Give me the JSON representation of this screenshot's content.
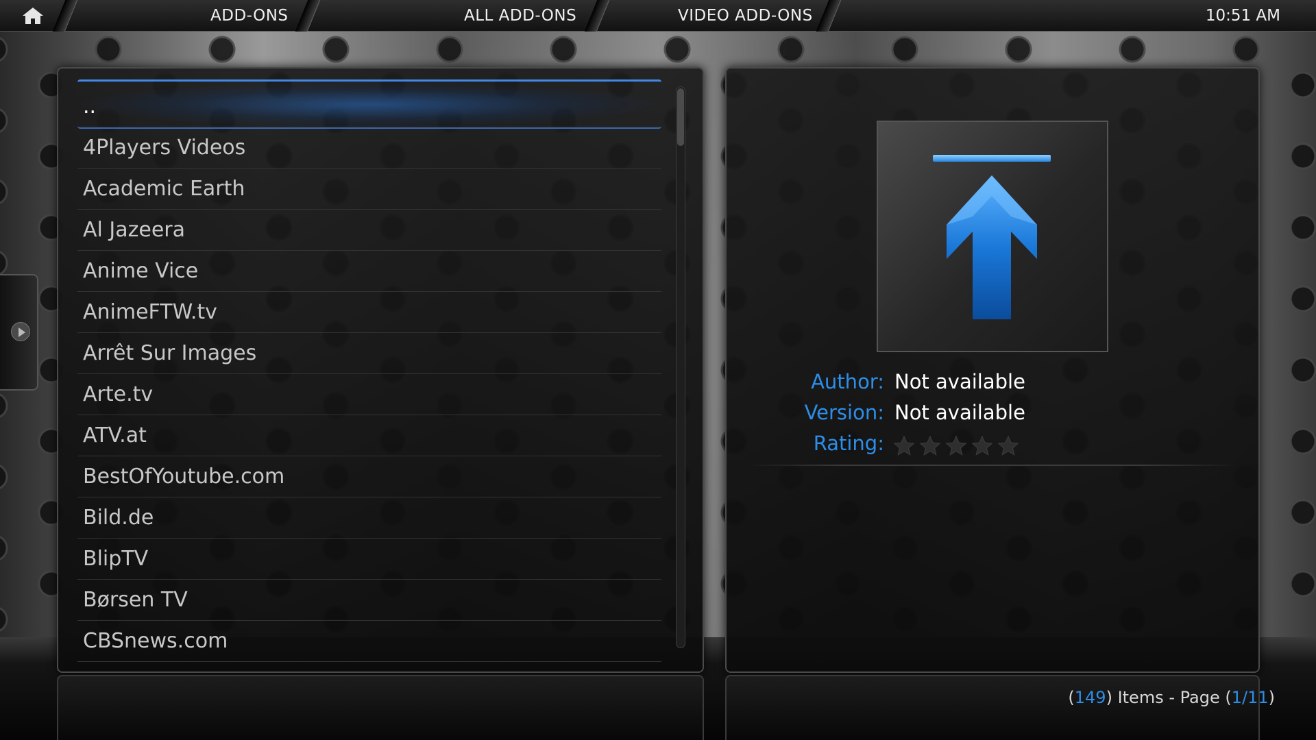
{
  "header": {
    "breadcrumbs": [
      "ADD-ONS",
      "ALL ADD-ONS",
      "VIDEO ADD-ONS"
    ],
    "clock": "10:51 AM"
  },
  "list": {
    "items": [
      "..",
      "4Players Videos",
      "Academic Earth",
      "Al Jazeera",
      "Anime Vice",
      "AnimeFTW.tv",
      "Arrêt Sur Images",
      "Arte.tv",
      "ATV.at",
      "BestOfYoutube.com",
      "Bild.de",
      "BlipTV",
      "Børsen TV",
      "CBSnews.com"
    ],
    "focused_index": 0
  },
  "details": {
    "author_label": "Author:",
    "author_value": "Not available",
    "version_label": "Version:",
    "version_value": "Not available",
    "rating_label": "Rating:",
    "rating_stars": 0,
    "rating_max": 5
  },
  "footer": {
    "open_paren": "(",
    "item_count": "149",
    "items_text": ") Items - Page (",
    "page": "1/11",
    "close_paren": ")"
  },
  "colors": {
    "accent": "#2d8ee8",
    "arrow_blue": "#1a78d8"
  }
}
